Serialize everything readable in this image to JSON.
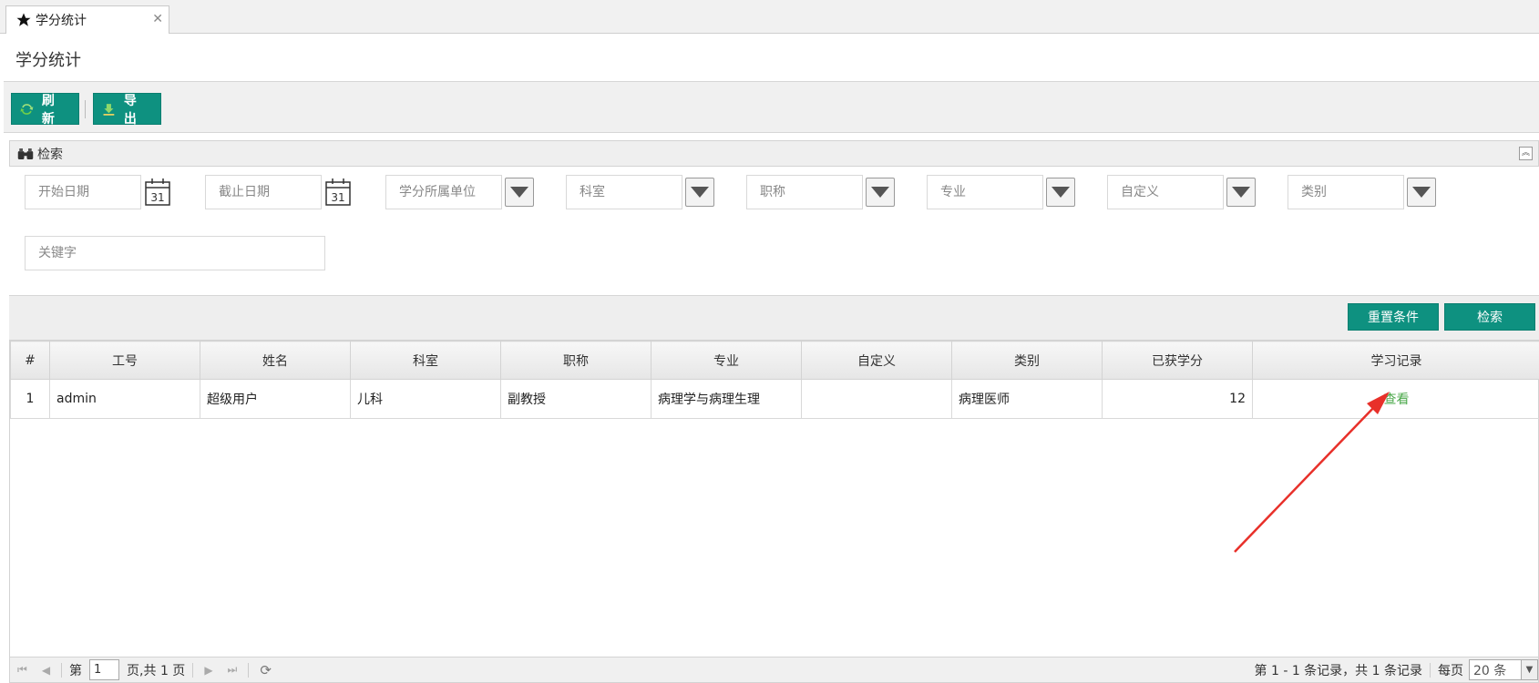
{
  "tab": {
    "label": "学分统计",
    "close": "✕"
  },
  "page": {
    "title": "学分统计"
  },
  "toolbar": {
    "refresh_label": "刷新",
    "export_label": "导出"
  },
  "search": {
    "header": "检索",
    "start_date_placeholder": "开始日期",
    "end_date_placeholder": "截止日期",
    "calendar_day": "31",
    "unit_placeholder": "学分所属单位",
    "dept_placeholder": "科室",
    "title_placeholder": "职称",
    "major_placeholder": "专业",
    "custom_placeholder": "自定义",
    "category_placeholder": "类别",
    "keyword_placeholder": "关键字",
    "reset_label": "重置条件",
    "search_label": "检索"
  },
  "grid": {
    "columns": [
      "#",
      "工号",
      "姓名",
      "科室",
      "职称",
      "专业",
      "自定义",
      "类别",
      "已获学分",
      "学习记录"
    ],
    "rows": [
      {
        "index": "1",
        "emp_id": "admin",
        "name": "超级用户",
        "dept": "儿科",
        "title": "副教授",
        "major": "病理学与病理生理",
        "custom": "",
        "category": "病理医师",
        "credits": "12",
        "record": "查看"
      }
    ]
  },
  "pager": {
    "page_prefix": "第",
    "page_value": "1",
    "page_suffix": "页,共 1 页",
    "summary": "第 1 - 1 条记录，共 1 条记录",
    "per_page_label": "每页",
    "per_page_value": "20 条"
  },
  "colors": {
    "accent": "#0e9180",
    "link": "#4aa84a",
    "annotation": "#e8302a"
  }
}
